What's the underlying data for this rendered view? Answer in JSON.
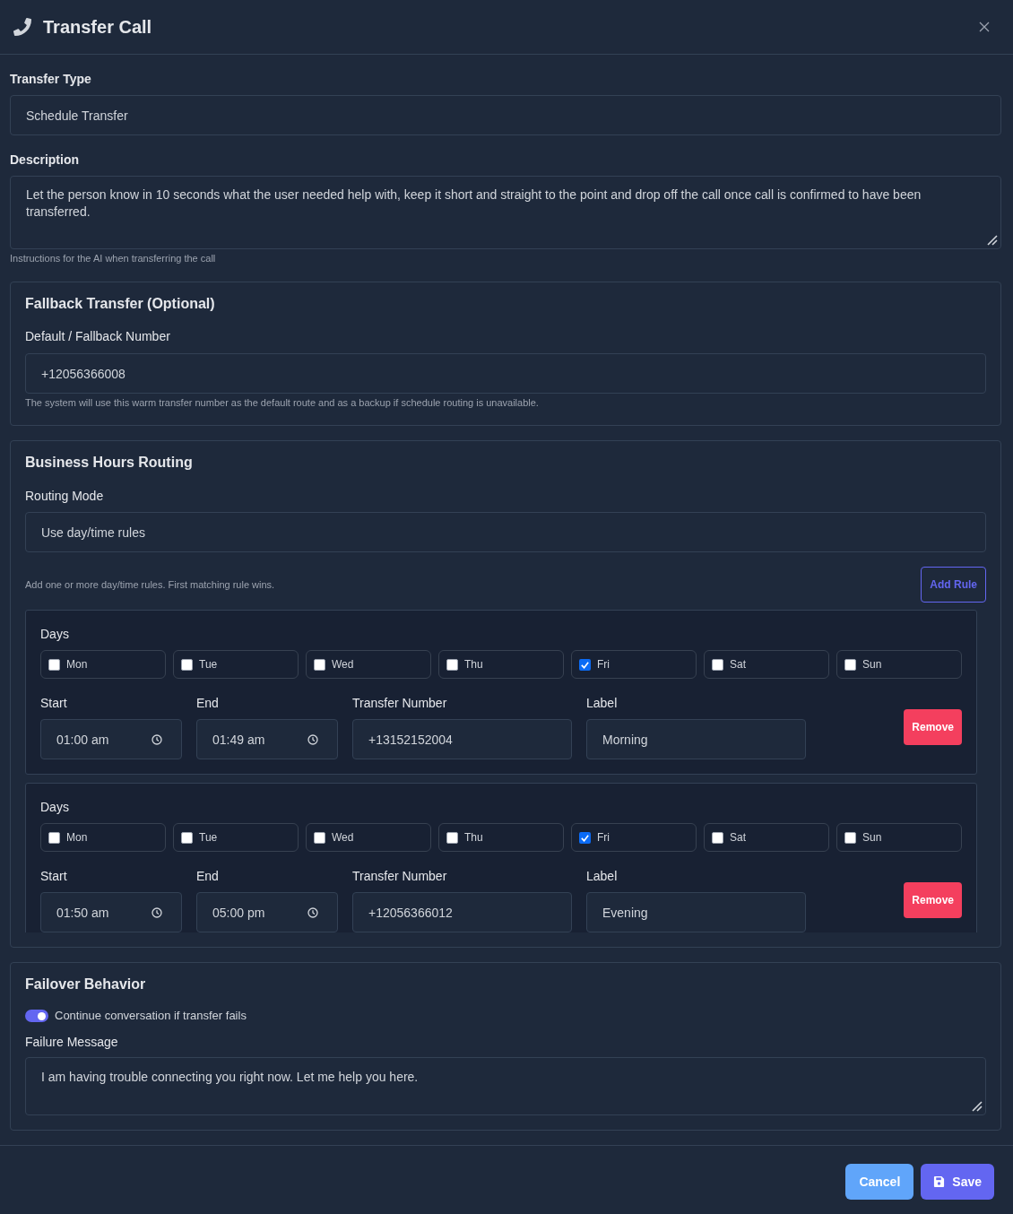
{
  "dialog": {
    "title": "Transfer Call"
  },
  "transfer_type": {
    "label": "Transfer Type",
    "value": "Schedule Transfer"
  },
  "description": {
    "label": "Description",
    "value": "Let the person know in 10 seconds what the user needed help with, keep it short and straight to the point and drop off the call once call is confirmed to have been transferred.",
    "hint": "Instructions for the AI when transferring the call"
  },
  "fallback": {
    "title": "Fallback Transfer (Optional)",
    "number_label": "Default / Fallback Number",
    "number": "+12056366008",
    "hint": "The system will use this warm transfer number as the default route and as a backup if schedule routing is unavailable."
  },
  "business_hours": {
    "title": "Business Hours Routing",
    "routing_mode_label": "Routing Mode",
    "routing_mode": "Use day/time rules",
    "hint": "Add one or more day/time rules. First matching rule wins.",
    "add_button": "Add Rule",
    "rules": [
      {
        "days_label": "Days",
        "days": [
          {
            "label": "Mon",
            "checked": false
          },
          {
            "label": "Tue",
            "checked": false
          },
          {
            "label": "Wed",
            "checked": false
          },
          {
            "label": "Thu",
            "checked": false
          },
          {
            "label": "Fri",
            "checked": true
          },
          {
            "label": "Sat",
            "checked": false
          },
          {
            "label": "Sun",
            "checked": false
          }
        ],
        "start_label": "Start",
        "start": "01:00 am",
        "end_label": "End",
        "end": "01:49 am",
        "number_label": "Transfer Number",
        "number": "+13152152004",
        "name_label": "Label",
        "name": "Morning",
        "remove_button": "Remove"
      },
      {
        "days_label": "Days",
        "days": [
          {
            "label": "Mon",
            "checked": false
          },
          {
            "label": "Tue",
            "checked": false
          },
          {
            "label": "Wed",
            "checked": false
          },
          {
            "label": "Thu",
            "checked": false
          },
          {
            "label": "Fri",
            "checked": true
          },
          {
            "label": "Sat",
            "checked": false
          },
          {
            "label": "Sun",
            "checked": false
          }
        ],
        "start_label": "Start",
        "start": "01:50 am",
        "end_label": "End",
        "end": "05:00 pm",
        "number_label": "Transfer Number",
        "number": "+12056366012",
        "name_label": "Label",
        "name": "Evening",
        "remove_button": "Remove"
      }
    ]
  },
  "failover": {
    "title": "Failover Behavior",
    "toggle": {
      "label": "Continue conversation if transfer fails",
      "on": true
    },
    "message_label": "Failure Message",
    "message": "I am having trouble connecting you right now. Let me help you here."
  },
  "footer": {
    "buttons": [
      {
        "label": "Cancel",
        "kind": "secondary"
      },
      {
        "label": "Save",
        "kind": "primary"
      }
    ]
  }
}
